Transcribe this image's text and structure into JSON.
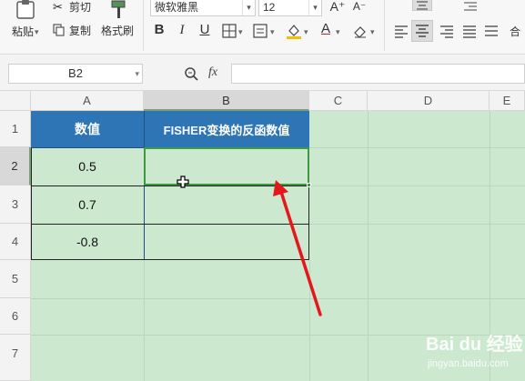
{
  "toolbar": {
    "paste_label": "粘贴",
    "cut_label": "剪切",
    "copy_label": "复制",
    "format_painter_label": "格式刷",
    "font_name": "微软雅黑",
    "font_size": "12",
    "bold_label": "B",
    "italic_label": "I",
    "underline_label": "U",
    "font_color_label": "A",
    "grow_font_label": "A⁺",
    "shrink_font_label": "A⁻",
    "merge_label": "合"
  },
  "formula_bar": {
    "cell_ref": "B2",
    "fx_label": "fx",
    "formula": ""
  },
  "columns": [
    {
      "label": "A"
    },
    {
      "label": "B"
    },
    {
      "label": "C"
    },
    {
      "label": "D"
    },
    {
      "label": "E"
    }
  ],
  "rows": [
    "1",
    "2",
    "3",
    "4",
    "5",
    "6",
    "7"
  ],
  "table": {
    "headers": [
      "数值",
      "FISHER变换的反函数值"
    ],
    "values": [
      "0.5",
      "0.7",
      "-0.8"
    ]
  },
  "watermark": {
    "text": "Bai du 经验",
    "sub": "jingyan.baidu.com"
  },
  "colors": {
    "header_fill": "#2e75b6",
    "sheet_bg": "#cce8cf",
    "selection": "#3f9a3f",
    "arrow": "#e3171c"
  }
}
